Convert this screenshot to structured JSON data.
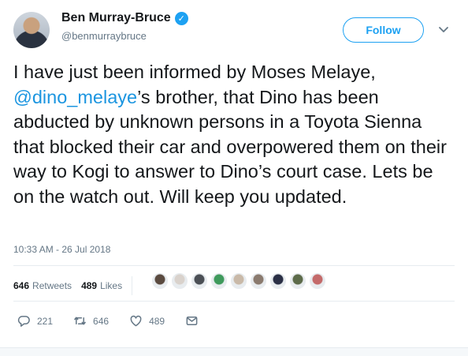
{
  "author": {
    "display_name": "Ben Murray-Bruce",
    "handle": "@benmurraybruce"
  },
  "follow_label": "Follow",
  "tweet": {
    "text_before": "I have just been informed by Moses Melaye, ",
    "mention": "@dino_melaye",
    "text_after": "’s brother, that Dino has been abducted by unknown persons in a Toyota Sienna that blocked their car and overpowered them on their way to Kogi to answer to Dino’s court case. Lets be on the watch out. Will keep you updated.",
    "timestamp": "10:33 AM - 26 Jul 2018"
  },
  "stats": {
    "retweets_count": "646",
    "retweets_label": "Retweets",
    "likes_count": "489",
    "likes_label": "Likes"
  },
  "liker_colors": [
    "#5a4a3f",
    "#d9d2cc",
    "#4b4f55",
    "#3f9a5c",
    "#c9b9a8",
    "#8a7a6e",
    "#2a2f45",
    "#5d6b4a",
    "#c46a6a"
  ],
  "actions": {
    "reply_count": "221",
    "retweet_count": "646",
    "like_count": "489"
  },
  "icons": {
    "verified": "verified-badge-icon",
    "reply": "reply-icon",
    "retweet": "retweet-icon",
    "like": "heart-icon",
    "dm": "envelope-icon",
    "caret": "chevron-down-icon"
  },
  "colors": {
    "accent": "#1da1f2",
    "mention": "#1b95e0",
    "muted": "#657786"
  }
}
